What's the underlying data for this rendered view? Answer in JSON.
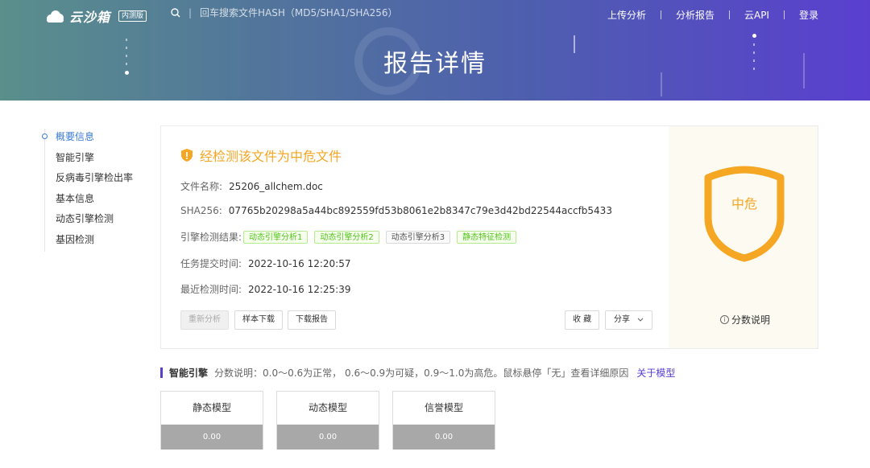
{
  "header": {
    "logo_text": "云沙箱",
    "logo_badge": "内测版",
    "search_placeholder": "回车搜索文件HASH（MD5/SHA1/SHA256）",
    "nav": [
      "上传分析",
      "分析报告",
      "云API",
      "登录"
    ],
    "page_title": "报告详情"
  },
  "sidebar": {
    "items": [
      "概要信息",
      "智能引擎",
      "反病毒引擎检出率",
      "基本信息",
      "动态引擎检测",
      "基因检测"
    ],
    "active_index": 0
  },
  "summary": {
    "verdict": "经检测该文件为中危文件",
    "file_name_label": "文件名称:",
    "file_name": "25206_allchem.doc",
    "sha256_label": "SHA256:",
    "sha256": "07765b20298a5a44bc892559fd53b8061e2b8347c79e3d42bd22544accfb5433",
    "engine_label": "引擎检测结果:",
    "engine_tags": [
      {
        "label": "动态引擎分析1",
        "style": "green"
      },
      {
        "label": "动态引擎分析2",
        "style": "green"
      },
      {
        "label": "动态引擎分析3",
        "style": "gray"
      },
      {
        "label": "静态特征检测",
        "style": "green"
      }
    ],
    "submit_time_label": "任务提交时间:",
    "submit_time": "2022-10-16 12:20:57",
    "recent_time_label": "最近检测时间:",
    "recent_time": "2022-10-16 12:25:39",
    "buttons": {
      "reanalyze": "重新分析",
      "download_sample": "样本下载",
      "download_report": "下载报告",
      "favorite": "收 藏",
      "share": "分享"
    },
    "risk_level": "中危",
    "score_explain": "分数说明",
    "colors": {
      "risk": "#f5a623",
      "accent": "#5a3fcf",
      "link": "#3a7bd5"
    }
  },
  "engine_section": {
    "title": "智能引擎",
    "description": "分数说明：0.0～0.6为正常， 0.6～0.9为可疑，0.9～1.0为高危。鼠标悬停「无」查看详细原因",
    "link": "关于模型",
    "models": [
      {
        "name": "静态模型",
        "score": "0.00"
      },
      {
        "name": "动态模型",
        "score": "0.00"
      },
      {
        "name": "信誉模型",
        "score": "0.00"
      }
    ]
  }
}
